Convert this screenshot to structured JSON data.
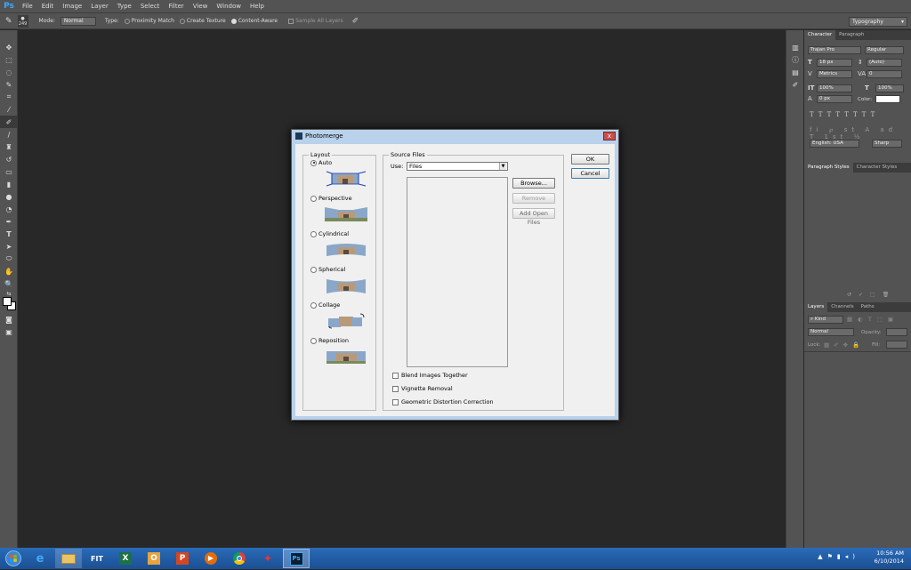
{
  "menubar": {
    "logo": "Ps",
    "items": [
      "File",
      "Edit",
      "Image",
      "Layer",
      "Type",
      "Select",
      "Filter",
      "View",
      "Window",
      "Help"
    ]
  },
  "options": {
    "brush_size": "249",
    "mode_label": "Mode:",
    "mode_value": "Normal",
    "type_label": "Type:",
    "type_options": [
      "Proximity Match",
      "Create Texture",
      "Content-Aware"
    ],
    "type_selected": "Content-Aware",
    "sample_all_layers": "Sample All Layers",
    "workspace": "Typography"
  },
  "character_panel": {
    "tabs": [
      "Character",
      "Paragraph"
    ],
    "font_family": "Trajan Pro",
    "font_style": "Regular",
    "font_size": "18 px",
    "leading": "(Auto)",
    "kerning": "Metrics",
    "tracking": "0",
    "vertical_scale": "100%",
    "horizontal_scale": "100%",
    "baseline_shift": "0 px",
    "color_label": "Color:",
    "language": "English: USA",
    "antialias": "Sharp"
  },
  "styles_panel": {
    "tabs": [
      "Paragraph Styles",
      "Character Styles"
    ]
  },
  "layers_panel": {
    "tabs": [
      "Layers",
      "Channels",
      "Paths"
    ],
    "filter": "Kind",
    "blend_mode": "Normal",
    "opacity_label": "Opacity:",
    "lock_label": "Lock:",
    "fill_label": "Fill:"
  },
  "dialog": {
    "title": "Photomerge",
    "close": "x",
    "layout_title": "Layout",
    "layouts": [
      "Auto",
      "Perspective",
      "Cylindrical",
      "Spherical",
      "Collage",
      "Reposition"
    ],
    "layout_selected": "Auto",
    "source_title": "Source Files",
    "use_label": "Use:",
    "use_value": "Files",
    "browse": "Browse...",
    "remove": "Remove",
    "add_open": "Add Open Files",
    "ok": "OK",
    "cancel": "Cancel",
    "options": [
      "Blend Images Together",
      "Vignette Removal",
      "Geometric Distortion Correction"
    ]
  },
  "taskbar": {
    "time": "10:56 AM",
    "date": "6/10/2014",
    "apps": [
      "ie-icon",
      "explorer-icon",
      "fitb-icon",
      "excel-icon",
      "outlook-icon",
      "powerpoint-icon",
      "media-player-icon",
      "chrome-icon",
      "game-icon",
      "photoshop-icon"
    ]
  },
  "colors": {
    "ui_gray": "#535353",
    "canvas": "#282828",
    "taskbar": "#1f5aa3",
    "dialog_frame": "#b9d1ea"
  }
}
